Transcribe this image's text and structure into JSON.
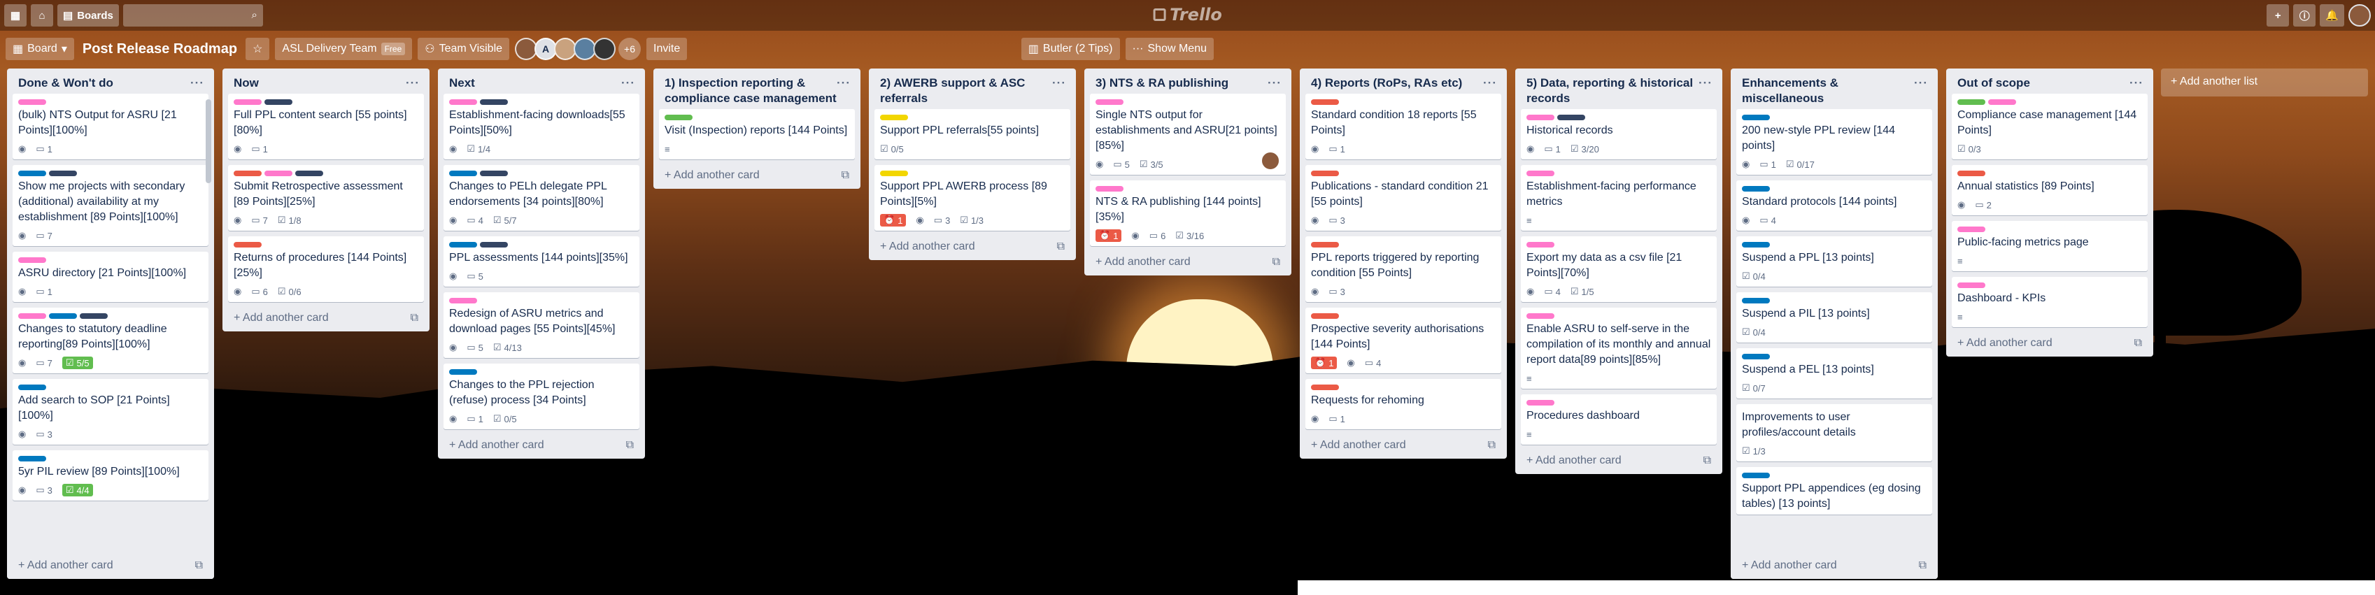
{
  "header": {
    "boards_label": "Boards",
    "logo_text": "Trello"
  },
  "board": {
    "menu_label": "Board",
    "title": "Post Release Roadmap",
    "team_label": "ASL Delivery Team",
    "free_badge": "Free",
    "visibility_label": "Team Visible",
    "member_initial": "A",
    "more_members": "+6",
    "invite_label": "Invite",
    "butler_label": "Butler (2 Tips)",
    "menu_toggle_label": "Show Menu"
  },
  "colors": {
    "pink": "#ff78cb",
    "navy": "#344563",
    "blue": "#0079bf",
    "red": "#eb5a46",
    "green": "#61bd4f",
    "yellow": "#f2d600"
  },
  "add_card_label": "Add another card",
  "add_list_label": "Add another list",
  "lists": [
    {
      "title": "Done & Won't do",
      "cards": [
        {
          "labels": [
            "pink"
          ],
          "title": "(bulk) NTS Output for ASRU [21 Points][100%]",
          "badges": {
            "watch": true,
            "comments": "1"
          }
        },
        {
          "labels": [
            "blue",
            "navy"
          ],
          "title": "Show me projects with secondary (additional) availability at my establishment [89 Points][100%]",
          "badges": {
            "watch": true,
            "comments": "7"
          }
        },
        {
          "labels": [
            "pink"
          ],
          "title": "ASRU directory [21 Points][100%]",
          "badges": {
            "watch": true,
            "comments": "1"
          }
        },
        {
          "labels": [
            "pink",
            "blue",
            "navy"
          ],
          "title": "Changes to statutory deadline reporting[89 Points][100%]",
          "badges": {
            "watch": true,
            "comments": "7",
            "checklist_done": "5/5"
          }
        },
        {
          "labels": [
            "blue"
          ],
          "title": "Add search to SOP [21 Points][100%]",
          "badges": {
            "watch": true,
            "comments": "3"
          }
        },
        {
          "labels": [
            "blue"
          ],
          "title": "5yr PIL review [89 Points][100%]",
          "badges": {
            "watch": true,
            "comments": "3",
            "checklist_done": "4/4"
          }
        }
      ]
    },
    {
      "title": "Now",
      "cards": [
        {
          "labels": [
            "pink",
            "navy"
          ],
          "title": "Full PPL content search [55 points][80%]",
          "badges": {
            "watch": true,
            "comments": "1"
          }
        },
        {
          "labels": [
            "red",
            "pink",
            "navy"
          ],
          "title": "Submit Retrospective assessment [89 Points][25%]",
          "badges": {
            "watch": true,
            "comments": "7",
            "checklist": "1/8"
          }
        },
        {
          "labels": [
            "red"
          ],
          "title": "Returns of procedures [144 Points][25%]",
          "badges": {
            "watch": true,
            "comments": "6",
            "checklist": "0/6"
          }
        }
      ]
    },
    {
      "title": "Next",
      "cards": [
        {
          "labels": [
            "pink",
            "navy"
          ],
          "title": "Establishment-facing downloads[55 Points][50%]",
          "badges": {
            "watch": true,
            "checklist": "1/4"
          }
        },
        {
          "labels": [
            "blue",
            "navy"
          ],
          "title": "Changes to PELh delegate PPL endorsements [34 points][80%]",
          "badges": {
            "watch": true,
            "comments": "4",
            "checklist": "5/7"
          }
        },
        {
          "labels": [
            "blue",
            "navy"
          ],
          "title": "PPL assessments [144 points][35%]",
          "badges": {
            "watch": true,
            "comments": "5"
          }
        },
        {
          "labels": [
            "pink"
          ],
          "title": "Redesign of ASRU metrics and download pages [55 Points][45%]",
          "badges": {
            "watch": true,
            "comments": "5",
            "checklist": "4/13"
          }
        },
        {
          "labels": [
            "blue"
          ],
          "title": "Changes to the PPL rejection (refuse) process [34 Points]",
          "badges": {
            "watch": true,
            "comments": "1",
            "checklist": "0/5"
          }
        }
      ]
    },
    {
      "title": "1) Inspection reporting & compliance case management",
      "cards": [
        {
          "labels": [
            "green"
          ],
          "title": "Visit (Inspection) reports [144 Points]",
          "badges": {
            "description": true
          }
        }
      ]
    },
    {
      "title": "2) AWERB support & ASC referrals",
      "cards": [
        {
          "labels": [
            "yellow"
          ],
          "title": "Support PPL referrals[55 points]",
          "badges": {
            "checklist": "0/5"
          }
        },
        {
          "labels": [
            "yellow"
          ],
          "title": "Support PPL AWERB process [89 Points][5%]",
          "badges": {
            "alert": "1",
            "watch": true,
            "comments": "3",
            "checklist": "1/3"
          }
        }
      ]
    },
    {
      "title": "3) NTS & RA publishing",
      "cards": [
        {
          "labels": [
            "pink"
          ],
          "title": "Single NTS output for establishments and ASRU[21 points][85%]",
          "badges": {
            "watch": true,
            "comments": "5",
            "checklist": "3/5",
            "avatar": true
          }
        },
        {
          "labels": [
            "pink"
          ],
          "title": "NTS & RA publishing [144 points][35%]",
          "badges": {
            "alert": "1",
            "watch": true,
            "comments": "6",
            "checklist": "3/16"
          }
        }
      ]
    },
    {
      "title": "4) Reports (RoPs, RAs etc)",
      "cards": [
        {
          "labels": [
            "red"
          ],
          "title": "Standard condition 18 reports [55 Points]",
          "badges": {
            "watch": true,
            "comments": "1"
          }
        },
        {
          "labels": [
            "red"
          ],
          "title": "Publications - standard condition 21 [55 points]",
          "badges": {
            "watch": true,
            "comments": "3"
          }
        },
        {
          "labels": [
            "red"
          ],
          "title": "PPL reports triggered by reporting condition [55 Points]",
          "badges": {
            "watch": true,
            "comments": "3"
          }
        },
        {
          "labels": [
            "red"
          ],
          "title": "Prospective severity authorisations [144 Points]",
          "badges": {
            "alert": "1",
            "watch": true,
            "comments": "4"
          }
        },
        {
          "labels": [
            "red"
          ],
          "title": "Requests for rehoming",
          "badges": {
            "watch": true,
            "comments": "1"
          }
        }
      ]
    },
    {
      "title": "5) Data, reporting & historical records",
      "cards": [
        {
          "labels": [
            "pink",
            "navy"
          ],
          "title": "Historical records",
          "badges": {
            "watch": true,
            "comments": "1",
            "checklist": "3/20"
          }
        },
        {
          "labels": [
            "pink"
          ],
          "title": "Establishment-facing performance metrics",
          "badges": {
            "description": true
          }
        },
        {
          "labels": [
            "pink"
          ],
          "title": "Export my data as a csv file [21 Points][70%]",
          "badges": {
            "watch": true,
            "comments": "4",
            "checklist": "1/5"
          }
        },
        {
          "labels": [
            "pink"
          ],
          "title": "Enable ASRU to self-serve in the compilation of its monthly and annual report data[89 points][85%]",
          "badges": {
            "description": true
          }
        },
        {
          "labels": [
            "pink"
          ],
          "title": "Procedures dashboard",
          "badges": {
            "description": true
          }
        }
      ]
    },
    {
      "title": "Enhancements & miscellaneous",
      "cards": [
        {
          "labels": [
            "blue"
          ],
          "title": "200 new-style PPL review [144 points]",
          "badges": {
            "watch": true,
            "comments": "1",
            "checklist": "0/17"
          }
        },
        {
          "labels": [
            "blue"
          ],
          "title": "Standard protocols [144 points]",
          "badges": {
            "watch": true,
            "comments": "4"
          }
        },
        {
          "labels": [
            "blue"
          ],
          "title": "Suspend a PPL [13 points]",
          "badges": {
            "checklist": "0/4"
          }
        },
        {
          "labels": [
            "blue"
          ],
          "title": "Suspend a PIL [13 points]",
          "badges": {
            "checklist": "0/4"
          }
        },
        {
          "labels": [
            "blue"
          ],
          "title": "Suspend a PEL [13 points]",
          "badges": {
            "checklist": "0/7"
          }
        },
        {
          "labels": [],
          "title": "Improvements to user profiles/account details",
          "badges": {
            "checklist": "1/3"
          }
        },
        {
          "labels": [
            "blue"
          ],
          "title": "Support PPL appendices (eg dosing tables) [13 points]",
          "badges": {}
        }
      ]
    },
    {
      "title": "Out of scope",
      "cards": [
        {
          "labels": [
            "green",
            "pink"
          ],
          "title": "Compliance case management [144 Points]",
          "badges": {
            "checklist": "0/3"
          }
        },
        {
          "labels": [
            "red"
          ],
          "title": "Annual statistics [89 Points]",
          "badges": {
            "watch": true,
            "comments": "2"
          }
        },
        {
          "labels": [
            "pink"
          ],
          "title": "Public-facing metrics page",
          "badges": {
            "description": true
          }
        },
        {
          "labels": [
            "pink"
          ],
          "title": "Dashboard - KPIs",
          "badges": {
            "description": true
          }
        }
      ]
    }
  ]
}
